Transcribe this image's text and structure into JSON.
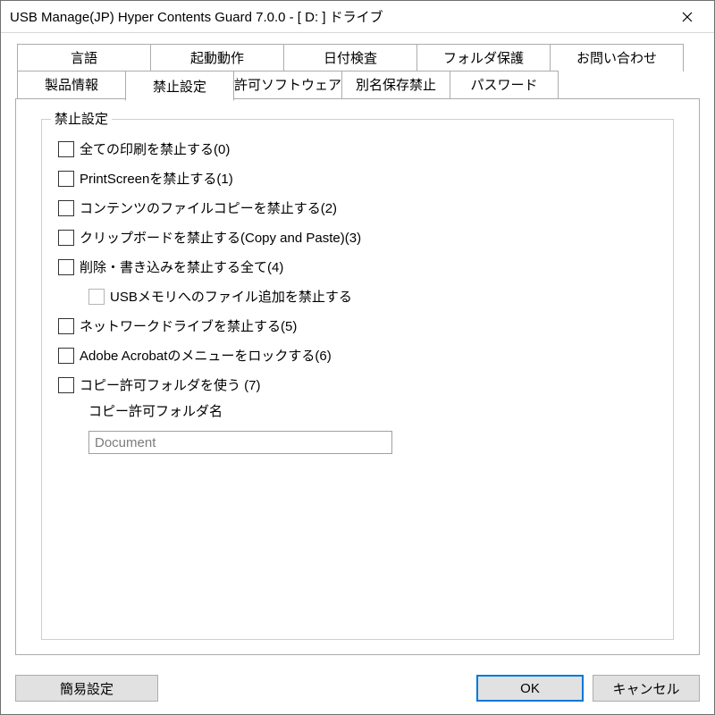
{
  "window": {
    "title": "USB Manage(JP) Hyper Contents Guard 7.0.0  - [ D: ] ドライブ"
  },
  "tabs": {
    "row1": [
      "言語",
      "起動動作",
      "日付検査",
      "フォルダ保護",
      "お問い合わせ"
    ],
    "row2": [
      "製品情報",
      "禁止設定",
      "許可ソフトウェア",
      "別名保存禁止",
      "パスワード"
    ],
    "activeRow": 2,
    "activeIndex": 1
  },
  "group": {
    "legend": "禁止設定",
    "items": [
      {
        "label": "全ての印刷を禁止する(0)",
        "checked": false,
        "indent": false
      },
      {
        "label": "PrintScreenを禁止する(1)",
        "checked": false,
        "indent": false
      },
      {
        "label": "コンテンツのファイルコピーを禁止する(2)",
        "checked": false,
        "indent": false
      },
      {
        "label": "クリップボードを禁止する(Copy and Paste)(3)",
        "checked": false,
        "indent": false
      },
      {
        "label": "削除・書き込みを禁止する全て(4)",
        "checked": false,
        "indent": false
      },
      {
        "label": "USBメモリへのファイル追加を禁止する",
        "checked": false,
        "indent": true,
        "disabled": true
      },
      {
        "label": "ネットワークドライブを禁止する(5)",
        "checked": false,
        "indent": false
      },
      {
        "label": "Adobe Acrobatのメニューをロックする(6)",
        "checked": false,
        "indent": false
      },
      {
        "label": "コピー許可フォルダを使う (7)",
        "checked": false,
        "indent": false
      }
    ],
    "folder_label": "コピー許可フォルダ名",
    "folder_value": "Document"
  },
  "buttons": {
    "simple": "簡易設定",
    "ok": "OK",
    "cancel": "キャンセル"
  }
}
